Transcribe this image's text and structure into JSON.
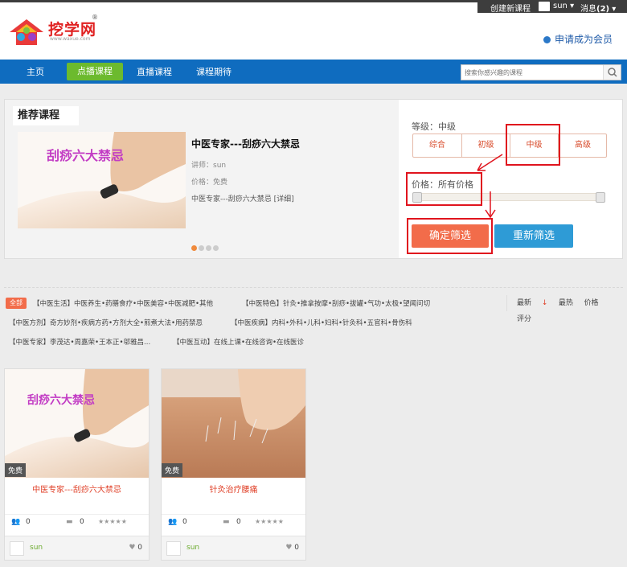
{
  "topbar": {
    "create_course": "创建新课程",
    "user": "sun",
    "messages": "消息",
    "message_count": "(2)"
  },
  "logo": {
    "text": "挖学网",
    "url": "www.waxue.com",
    "reg": "®"
  },
  "header": {
    "member": "申请成为会员"
  },
  "nav": {
    "items": [
      "主页",
      "点播课程",
      "直播课程",
      "课程期待"
    ],
    "active": "点播课程",
    "search_placeholder": "搜索你感兴趣的课程"
  },
  "recommended": {
    "heading": "推荐课程",
    "thumb_text": "刮痧六大禁忌",
    "course_title": "中医专家---刮痧六大禁忌",
    "lecturer": "讲师：sun",
    "price": "价格：免费",
    "desc": "中医专家---刮痧六大禁忌",
    "detail": "[详细]",
    "slide_count": 4,
    "slide_active": 0
  },
  "filter": {
    "level_label": "等级：中级",
    "levels": [
      "综合",
      "初级",
      "中级",
      "高级"
    ],
    "selected_level": "中级",
    "price_label": "价格：所有价格",
    "confirm": "确定筛选",
    "reset": "重新筛选"
  },
  "categories": {
    "all": "全部",
    "row1a": "【中医生活】中医养生•药膳食疗•中医美容•中医减肥•其他",
    "row1b": "【中医特色】针灸•推拿按摩•刮痧•拔罐•气功•太极•望闻问切",
    "row2a": "【中医方剂】奇方妙剂•疾病方药•方剂大全•煎煮大法•用药禁忌",
    "row2b": "【中医疾病】内科•外科•儿科•妇科•针灸科•五官科•骨伤科",
    "row3a": "【中医专家】李茂达•周嘉荣•王本正•邬雅昌...",
    "row3b": "【中医互动】在线上课•在线咨询•在线医诊"
  },
  "sort": {
    "newest": "最新",
    "hottest": "最热",
    "price": "价格",
    "rating": "评分"
  },
  "cards": [
    {
      "free": "免费",
      "title": "中医专家---刮痧六大禁忌",
      "image_text": "刮痧六大禁忌",
      "students": "0",
      "comments": "0",
      "user": "sun",
      "likes": "0",
      "rating": "★★★★★"
    },
    {
      "free": "免费",
      "title": "针灸治疗腰痛",
      "image_text": "",
      "students": "0",
      "comments": "0",
      "user": "sun",
      "likes": "0",
      "rating": "★★★★★"
    }
  ],
  "colors": {
    "nav": "#0f6cbf",
    "nav_active": "#6cba2e",
    "accent": "#f26c4a",
    "reset": "#2e9bd6",
    "annotation": "#e0141e"
  }
}
